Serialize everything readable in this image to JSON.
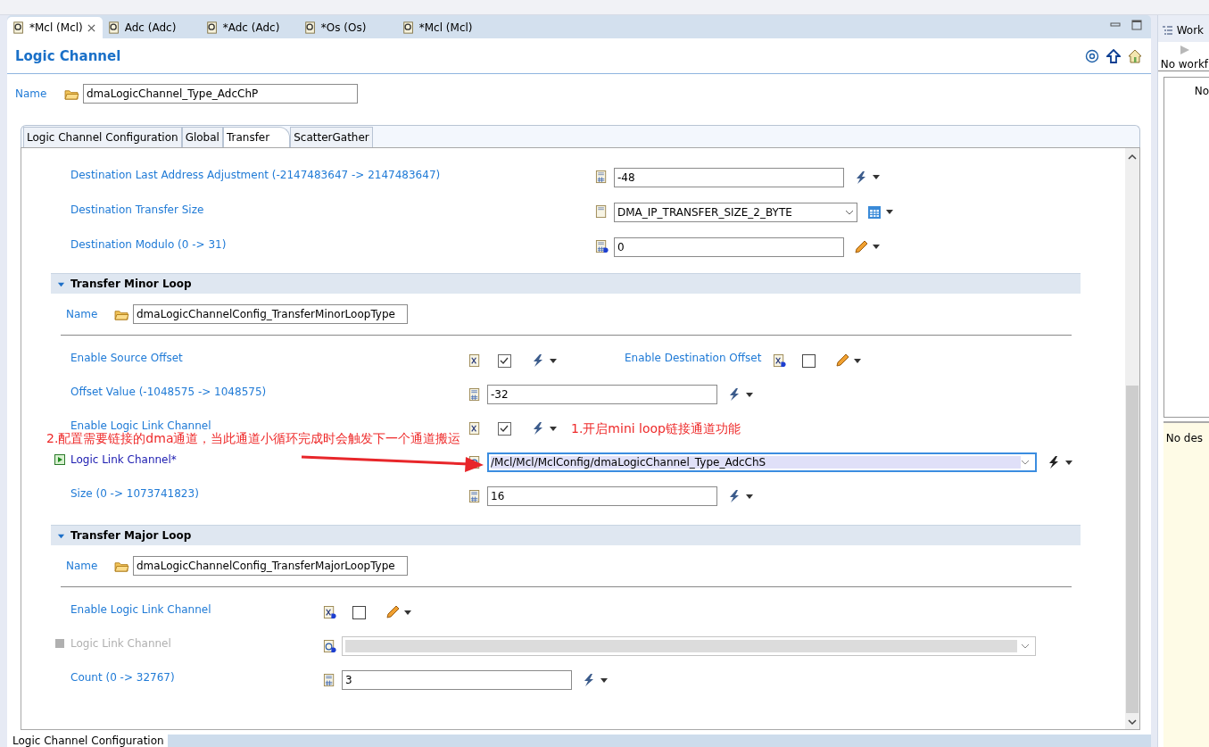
{
  "editor_tabs": [
    {
      "label": "*Mcl (Mcl)",
      "selected": true
    },
    {
      "label": "Adc (Adc)",
      "selected": false
    },
    {
      "label": "*Adc (Adc)",
      "selected": false
    },
    {
      "label": "*Os (Os)",
      "selected": false
    },
    {
      "label": "*Mcl (Mcl)",
      "selected": false
    }
  ],
  "editor": {
    "title": "Logic Channel",
    "name_label": "Name",
    "name_value": "dmaLogicChannel_Type_AdcChP"
  },
  "config_tabs": [
    {
      "label": "Logic Channel Configuration",
      "selected": false
    },
    {
      "label": "Global",
      "selected": false
    },
    {
      "label": "Transfer",
      "selected": true
    },
    {
      "label": "ScatterGather",
      "selected": false
    }
  ],
  "parameters": [
    {
      "kind": "number",
      "label": "Destination Last Address Adjustment (-2147483647 -> 2147483647)",
      "value": "-48",
      "editable": false
    },
    {
      "kind": "select",
      "label": "Destination Transfer Size",
      "value": "DMA_IP_TRANSFER_SIZE_2_BYTE",
      "editable": false
    },
    {
      "kind": "number",
      "label": "Destination Modulo (0 -> 31)",
      "value": "0",
      "editable": true
    }
  ],
  "sections": [
    {
      "title": "Transfer Minor Loop",
      "expanded": true,
      "name_label": "Name",
      "name_value": "dmaLogicChannelConfig_TransferMinorLoopType",
      "rows": [
        {
          "kind": "checkbox",
          "label": "Enable Source Offset",
          "checked": true,
          "editable": false,
          "paired": {
            "label": "Enable Destination Offset",
            "checked": false,
            "editable": true
          }
        },
        {
          "kind": "number",
          "label": "Offset Value (-1048575 -> 1048575)",
          "value": "-32",
          "editable": false
        },
        {
          "kind": "checkbox",
          "label": "Enable Logic Link Channel",
          "checked": true,
          "editable": false
        },
        {
          "kind": "reference",
          "label": "Logic Link Channel*",
          "value": "/Mcl/Mcl/MclConfig/dmaLogicChannel_Type_AdcChS",
          "editable": false,
          "enabled": true
        },
        {
          "kind": "number",
          "label": "Size (0 -> 1073741823)",
          "value": "16",
          "editable": false
        }
      ]
    },
    {
      "title": "Transfer Major Loop",
      "expanded": true,
      "name_label": "Name",
      "name_value": "dmaLogicChannelConfig_TransferMajorLoopType",
      "rows": [
        {
          "kind": "checkbox",
          "label": "Enable Logic Link Channel",
          "checked": false,
          "editable": true
        },
        {
          "kind": "reference",
          "label": "Logic Link Channel",
          "editable": true,
          "enabled": false
        },
        {
          "kind": "number",
          "label": "Count (0 -> 32767)",
          "value": "3",
          "editable": false
        }
      ]
    }
  ],
  "annotations": [
    {
      "text": "1.开启mini loop链接通道功能"
    },
    {
      "text": "2.配置需要链接的dma通道，当此通道小循环完成时会触发下一个通道搬运"
    }
  ],
  "side_panel": {
    "tab": "Work",
    "status": "No workf",
    "list_text": "No",
    "description": "No des"
  },
  "bottom_tab": "Logic Channel Configuration"
}
